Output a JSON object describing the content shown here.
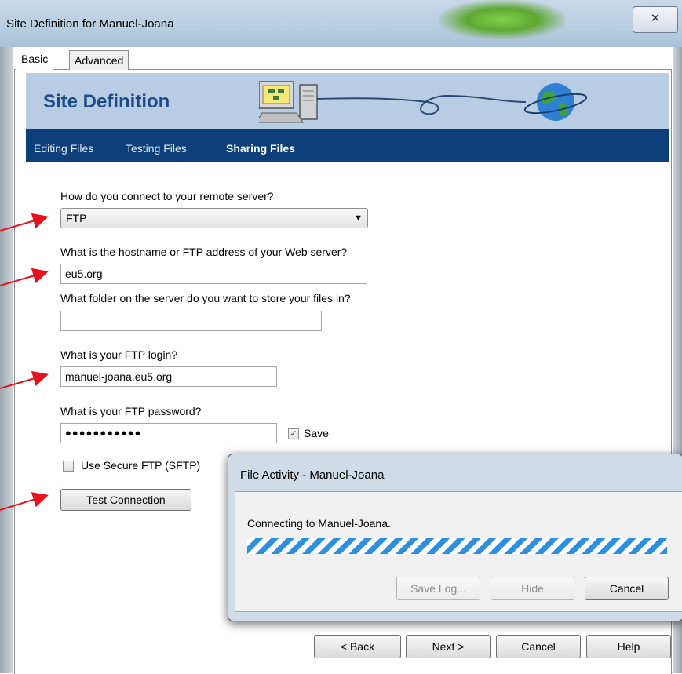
{
  "window": {
    "title": "Site Definition for Manuel-Joana",
    "close_glyph": "✕"
  },
  "tabs": [
    {
      "label": "Basic"
    },
    {
      "label": "Advanced"
    }
  ],
  "banner": {
    "title": "Site Definition"
  },
  "nav": [
    {
      "label": "Editing Files"
    },
    {
      "label": "Testing Files"
    },
    {
      "label": "Sharing Files",
      "active": true
    }
  ],
  "form": {
    "connect_label": "How do you connect to your remote server?",
    "connect_value": "FTP",
    "hostname_label": "What is the hostname or FTP address of your Web server?",
    "hostname_value": "eu5.org",
    "folder_label": "What folder on the server do you want to store your files in?",
    "folder_value": "",
    "login_label": "What is your FTP login?",
    "login_value": "manuel-joana.eu5.org",
    "password_label": "What is your FTP password?",
    "password_value": "●●●●●●●●●●●",
    "save_label": "Save",
    "save_checked": true,
    "sftp_label": "Use Secure FTP (SFTP)",
    "sftp_checked": false,
    "test_button": "Test Connection"
  },
  "dialog": {
    "title": "File Activity - Manuel-Joana",
    "status": "Connecting to Manuel-Joana.",
    "progress_fraction": 1.0,
    "buttons": {
      "save_log": "Save Log...",
      "hide": "Hide",
      "cancel": "Cancel"
    }
  },
  "footer": {
    "back": "< Back",
    "next": "Next >",
    "cancel": "Cancel",
    "help": "Help"
  },
  "colors": {
    "banner_bg": "#b8cde3",
    "nav_bg": "#0c3e7a",
    "arrow": "#e8121d",
    "progress": "#2c8fe0"
  }
}
